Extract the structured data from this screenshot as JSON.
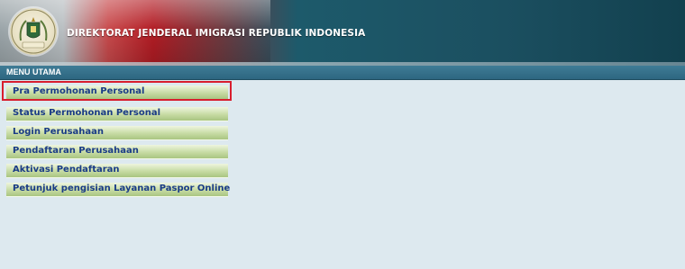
{
  "header": {
    "title": "DIREKTORAT JENDERAL IMIGRASI REPUBLIK INDONESIA",
    "logo_text": "IMIGRASI",
    "logo_icon": "imigrasi-emblem-icon"
  },
  "menu": {
    "title": "MENU UTAMA",
    "items": [
      {
        "label": "Pra Permohonan Personal",
        "highlighted": true
      },
      {
        "label": "Status Permohonan Personal"
      },
      {
        "label": "Login Perusahaan"
      },
      {
        "label": "Pendaftaran Perusahaan"
      },
      {
        "label": "Aktivasi Pendaftaran"
      },
      {
        "label": "Petunjuk pengisian Layanan Paspor Online"
      }
    ]
  },
  "colors": {
    "highlight_border": "#d81e2e",
    "menu_link": "#1a3c86",
    "content_background": "#dde9ef"
  }
}
